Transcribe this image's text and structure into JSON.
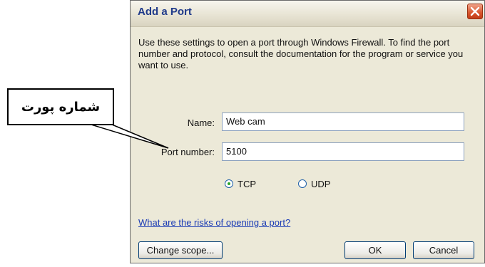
{
  "dialog": {
    "title": "Add a Port",
    "description": "Use these settings to open a port through Windows Firewall. To find the port number and protocol, consult the documentation for the program or service you want to use.",
    "name_label": "Name:",
    "name_value": "Web cam",
    "port_label": "Port number:",
    "port_value": "5100",
    "protocol": {
      "tcp_label": "TCP",
      "udp_label": "UDP",
      "selected": "TCP"
    },
    "risk_link": "What are the risks of opening a port?",
    "buttons": {
      "change_scope": "Change scope...",
      "ok": "OK",
      "cancel": "Cancel"
    },
    "icons": {
      "close": "close-icon"
    }
  },
  "annotation": {
    "text": "شماره پورت"
  }
}
